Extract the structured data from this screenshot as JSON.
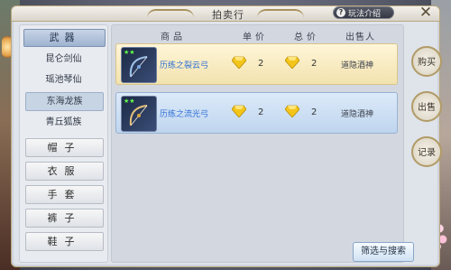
{
  "window": {
    "title": "拍卖行",
    "intro_label": "玩法介绍",
    "intro_icon": "?",
    "close_label": "✕"
  },
  "categories": {
    "active_header": "武器",
    "sub_items": [
      "昆仑剑仙",
      "瑶池琴仙",
      "东海龙族",
      "青丘狐族"
    ],
    "active_sub_index": 2,
    "others": [
      "帽子",
      "衣服",
      "手套",
      "裤子",
      "鞋子"
    ]
  },
  "table": {
    "headers": [
      "商品",
      "单价",
      "总价",
      "出售人"
    ],
    "rows": [
      {
        "name": "历练之裂云弓",
        "stars": "★★",
        "unit_price": "2",
        "total_price": "2",
        "seller": "道隐酒神"
      },
      {
        "name": "历练之流光弓",
        "stars": "★★",
        "unit_price": "2",
        "total_price": "2",
        "seller": "道隐酒神"
      }
    ]
  },
  "side_buttons": [
    "购买",
    "出售",
    "记录"
  ],
  "filter_button": "筛选与搜索",
  "colors": {
    "gold": "#f3c51a",
    "item_name": "#2f6fd6",
    "star": "#62ff4a"
  },
  "icons": {
    "price": "gem-icon",
    "close": "close-icon",
    "help": "help-icon"
  }
}
